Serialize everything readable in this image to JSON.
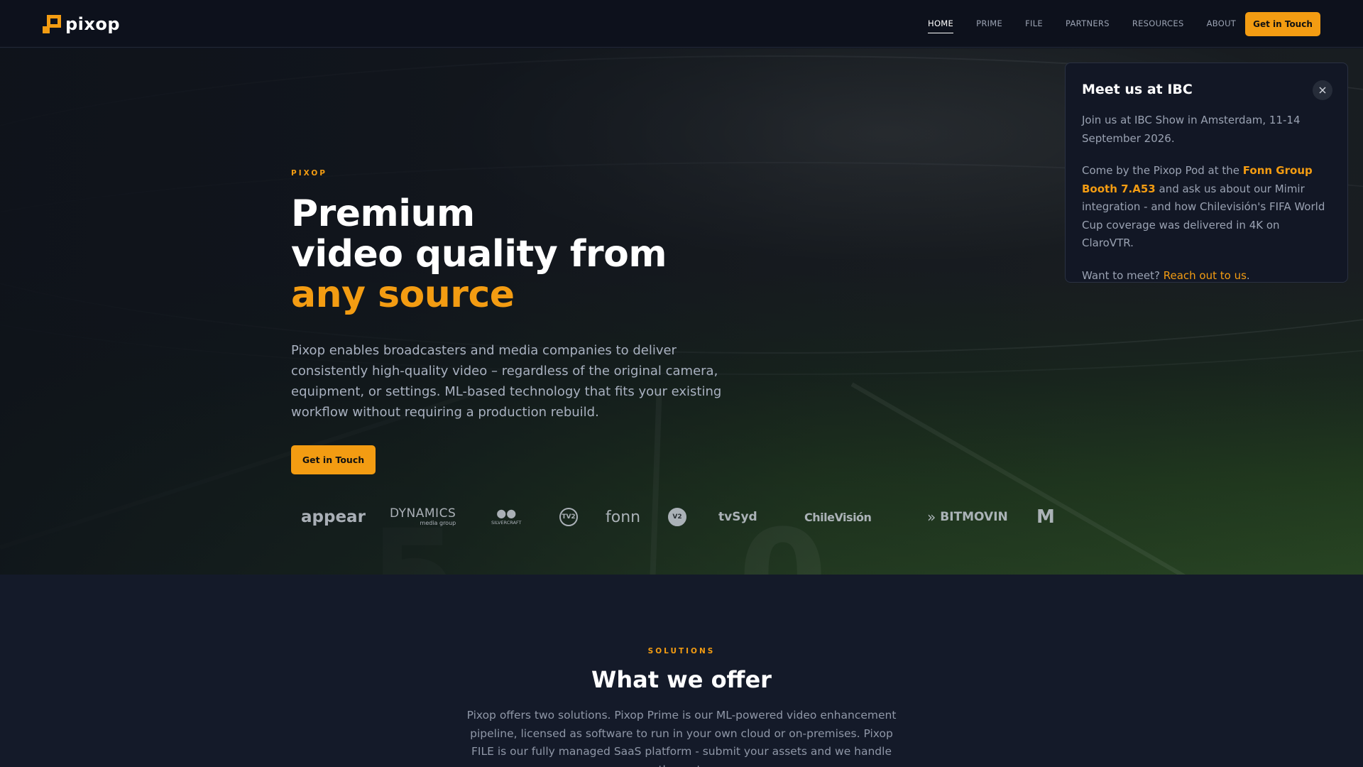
{
  "nav": {
    "brand": "pixop",
    "links": [
      "HOME",
      "PRIME",
      "FILE",
      "PARTNERS",
      "RESOURCES",
      "ABOUT"
    ],
    "active_link": "HOME",
    "cta_label": "Get in Touch"
  },
  "hero": {
    "eyebrow": "PIXOP",
    "headline_line1": "Premium",
    "headline_line2": "video quality from",
    "headline_accent": "any source",
    "description": "Pixop enables broadcasters and media companies to deliver consistently high-quality video – regardless of the original camera, equipment, or settings. ML-based technology that fits your existing workflow without requiring a production rebuild.",
    "cta_label": "Get in Touch",
    "client_logos": [
      "appear",
      "DYNAMICS",
      "media group",
      "SILVERCRAFT",
      "TV2",
      "fonn",
      "V2",
      "tvSyd",
      "ChileVisión",
      "BITMOVIN",
      "M"
    ]
  },
  "popup": {
    "title": "Meet us at IBC",
    "paragraph1": "Join us at IBC Show in Amsterdam, 11-14 September 2026.",
    "paragraph2_prefix": "Come by the Pixop Pod at the ",
    "paragraph2_highlight": "Fonn Group Booth 7.A53",
    "paragraph2_suffix": " and ask us about our Mimir integration - and how Chilevisión's FIFA World Cup coverage was delivered in 4K on ClaroVTR.",
    "paragraph3_prefix": "Want to meet? ",
    "paragraph3_link": "Reach out to us",
    "paragraph3_suffix": "."
  },
  "solutions": {
    "eyebrow": "SOLUTIONS",
    "title": "What we offer",
    "description": "Pixop offers two solutions. Pixop Prime is our ML-powered video enhancement pipeline, licensed as software to run in your own cloud or on-premises. Pixop FILE is our fully managed SaaS platform - submit your assets and we handle the rest."
  },
  "colors": {
    "accent": "#f39c12",
    "background": "#101522",
    "popup_bg": "#121725"
  },
  "icons": {
    "logo": "pixop-logo-icon",
    "close": "close-icon"
  }
}
